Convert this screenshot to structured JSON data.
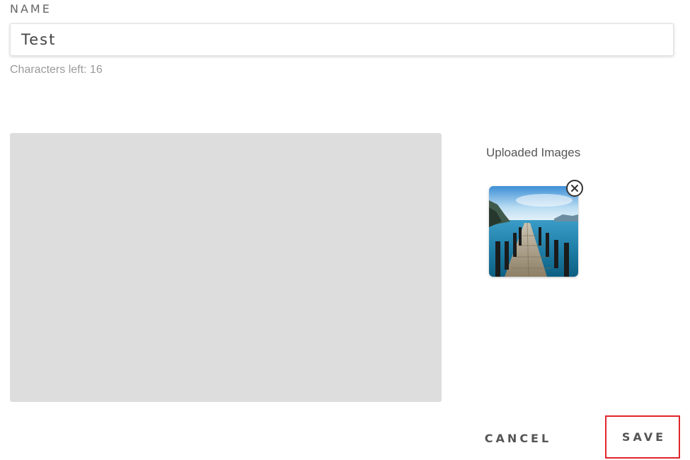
{
  "form": {
    "name_label": "NAME",
    "name_value": "Test",
    "chars_left": "Characters left: 16"
  },
  "uploads": {
    "title": "Uploaded Images",
    "images": [
      {
        "icon": "lake-pier-photo",
        "remove_icon": "close-circle-icon"
      }
    ]
  },
  "actions": {
    "cancel_label": "CANCEL",
    "save_label": "SAVE",
    "highlight_color": "#e0262b"
  },
  "colors": {
    "preview_background": "#dddddd",
    "text": "#555555",
    "muted_text": "#9a9a9a"
  }
}
